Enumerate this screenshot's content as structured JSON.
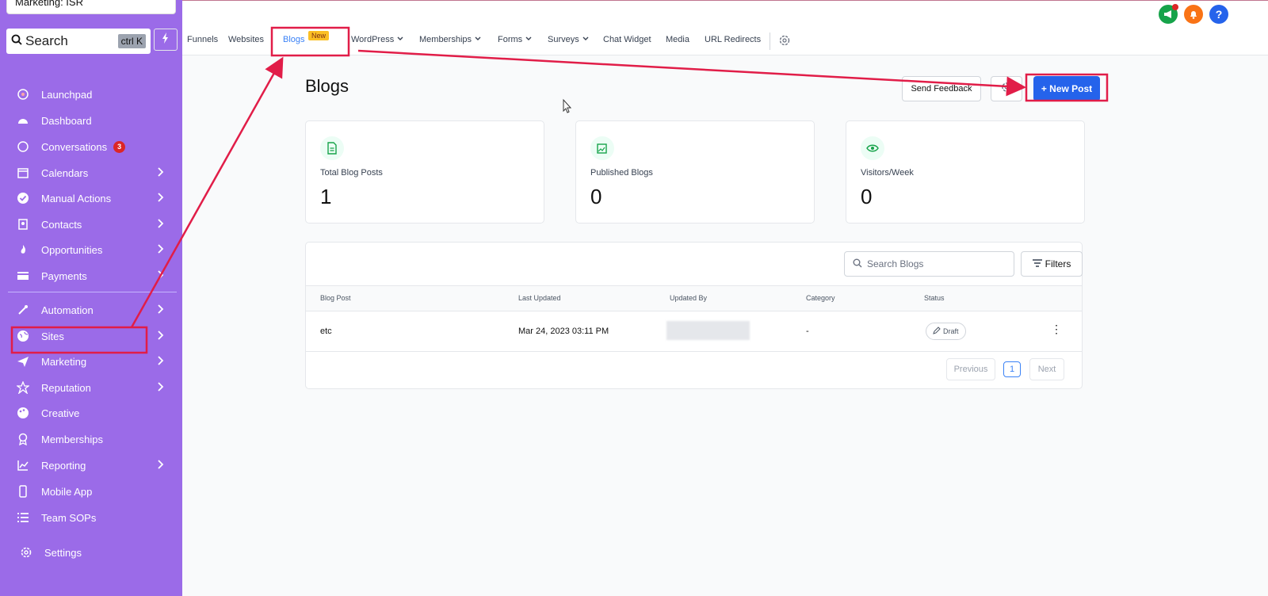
{
  "account": {
    "name": "Marketing: ISR"
  },
  "search": {
    "label": "Search",
    "shortcut": "ctrl K"
  },
  "sidebar": {
    "items": [
      {
        "label": "Launchpad",
        "icon": "rocket-icon"
      },
      {
        "label": "Dashboard",
        "icon": "gauge-icon"
      },
      {
        "label": "Conversations",
        "icon": "chat-icon",
        "badge": "3"
      },
      {
        "label": "Calendars",
        "icon": "calendar-icon"
      },
      {
        "label": "Manual Actions",
        "icon": "check-circle-icon"
      },
      {
        "label": "Contacts",
        "icon": "contact-card-icon"
      },
      {
        "label": "Opportunities",
        "icon": "flame-icon"
      },
      {
        "label": "Payments",
        "icon": "credit-card-icon"
      },
      {
        "label": "Automation",
        "icon": "magic-wand-icon"
      },
      {
        "label": "Sites",
        "icon": "globe-icon"
      },
      {
        "label": "Marketing",
        "icon": "paper-plane-icon"
      },
      {
        "label": "Reputation",
        "icon": "star-icon"
      },
      {
        "label": "Creative",
        "icon": "palette-icon"
      },
      {
        "label": "Memberships",
        "icon": "award-icon"
      },
      {
        "label": "Reporting",
        "icon": "chart-icon"
      },
      {
        "label": "Mobile App",
        "icon": "phone-icon"
      },
      {
        "label": "Team SOPs",
        "icon": "list-icon"
      }
    ],
    "settings": "Settings"
  },
  "topnav": {
    "tabs": [
      "Funnels",
      "Websites",
      "Blogs",
      "WordPress",
      "Memberships",
      "Forms",
      "Surveys",
      "Chat Widget",
      "Media",
      "URL Redirects"
    ],
    "new_tag": "New",
    "help": "?"
  },
  "page": {
    "title": "Blogs",
    "send_feedback": "Send Feedback",
    "new_post": "+ New Post"
  },
  "stats": [
    {
      "label": "Total Blog Posts",
      "value": "1"
    },
    {
      "label": "Published Blogs",
      "value": "0"
    },
    {
      "label": "Visitors/Week",
      "value": "0"
    }
  ],
  "table": {
    "search_placeholder": "Search Blogs",
    "filters": "Filters",
    "columns": [
      "Blog Post",
      "Last Updated",
      "Updated By",
      "Category",
      "Status"
    ],
    "rows": [
      {
        "post": "etc",
        "updated": "Mar 24, 2023 03:11 PM",
        "by": "",
        "category": "-",
        "status": "Draft"
      }
    ],
    "pagination": {
      "previous": "Previous",
      "page": "1",
      "next": "Next"
    }
  },
  "colors": {
    "sidebar": "#9b6be8",
    "accent": "#2563eb",
    "annotation": "#e11d48"
  }
}
